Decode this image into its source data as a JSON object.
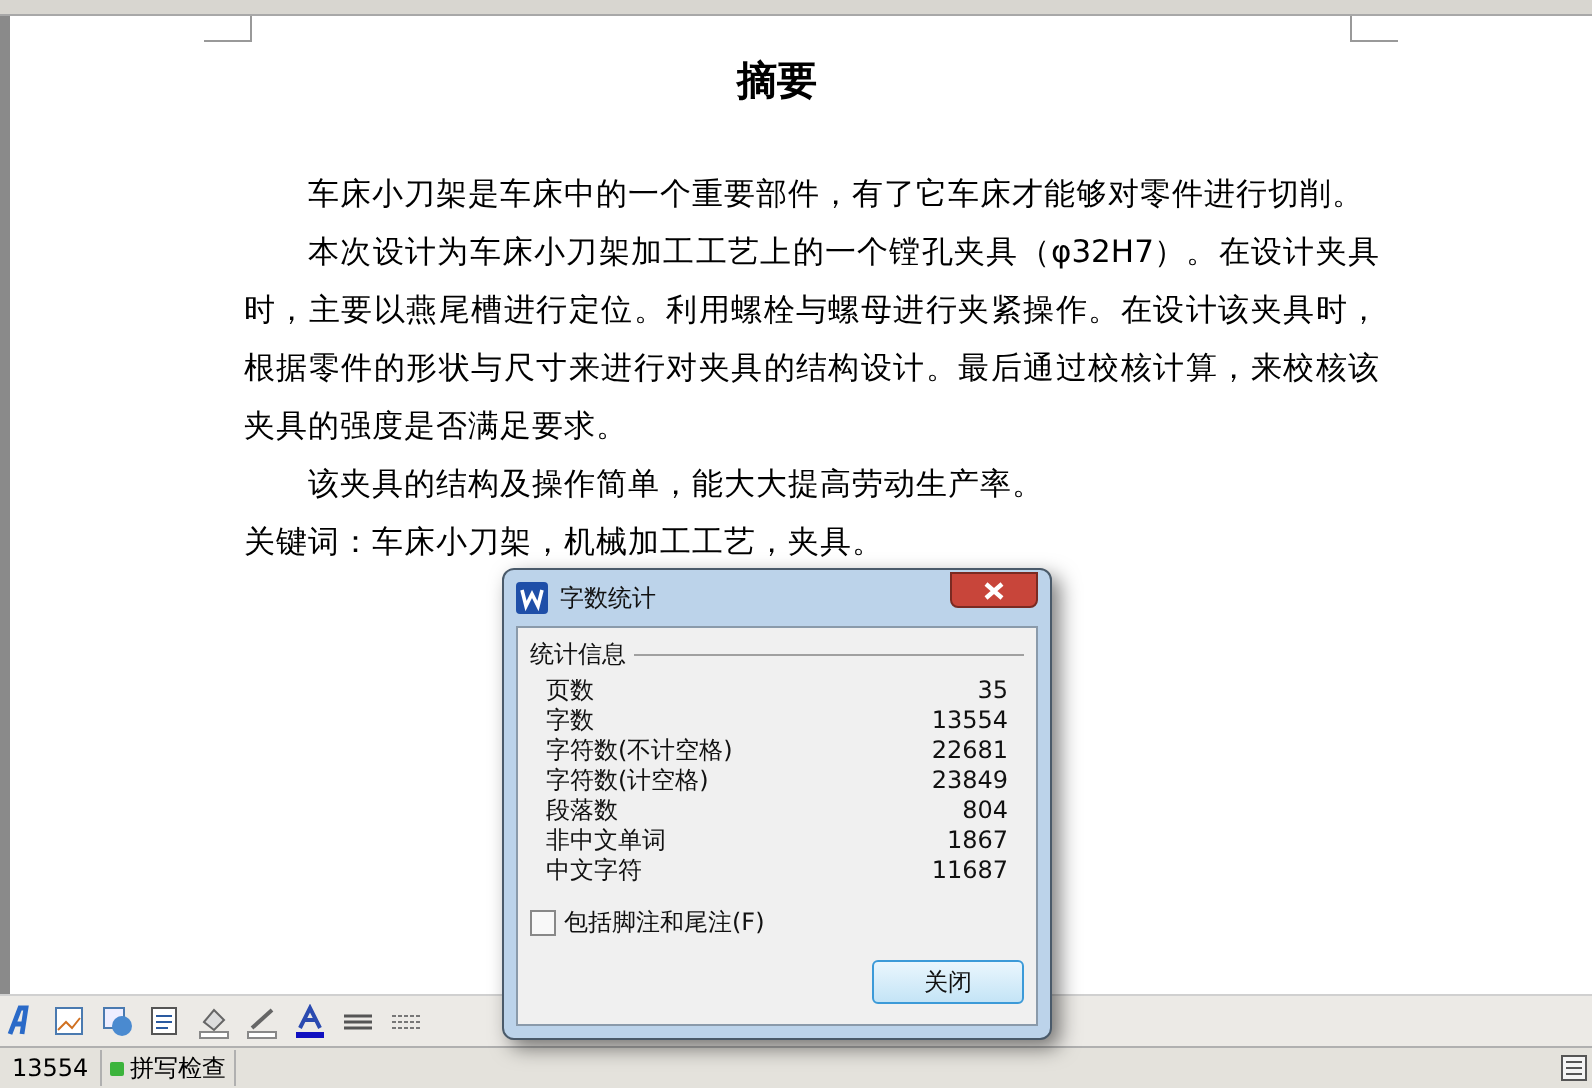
{
  "document": {
    "title": "摘要",
    "paragraphs": [
      {
        "kind": "body",
        "text": "车床小刀架是车床中的一个重要部件，有了它车床才能够对零件进行切削。"
      },
      {
        "kind": "body",
        "text": "本次设计为车床小刀架加工工艺上的一个镗孔夹具（φ32H7）。在设计夹具时，主要以燕尾槽进行定位。利用螺栓与螺母进行夹紧操作。在设计该夹具时，根据零件的形状与尺寸来进行对夹具的结构设计。最后通过校核计算，来校核该夹具的强度是否满足要求。"
      },
      {
        "kind": "body",
        "text": "该夹具的结构及操作简单，能大大提高劳动生产率。"
      },
      {
        "kind": "keywords",
        "text": "关键词：车床小刀架，机械加工工艺，夹具。"
      }
    ]
  },
  "dialog": {
    "title": "字数统计",
    "group": "统计信息",
    "stats": [
      {
        "label": "页数",
        "value": "35"
      },
      {
        "label": "字数",
        "value": "13554"
      },
      {
        "label": "字符数(不计空格)",
        "value": "22681"
      },
      {
        "label": "字符数(计空格)",
        "value": "23849"
      },
      {
        "label": "段落数",
        "value": "804"
      },
      {
        "label": "非中文单词",
        "value": "1867"
      },
      {
        "label": "中文字符",
        "value": "11687"
      }
    ],
    "checkbox": {
      "label": "包括脚注和尾注(F)",
      "checked": false
    },
    "button": "关闭"
  },
  "status_bar": {
    "word_count": "13554",
    "spell_check": "拼写检查"
  }
}
